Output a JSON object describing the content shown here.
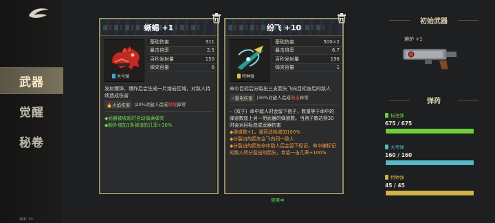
{
  "nav": {
    "items": [
      {
        "label": "武器",
        "active": true
      },
      {
        "label": "觉醒",
        "active": false
      },
      {
        "label": "秘卷",
        "active": false
      }
    ],
    "fps": "帧率: 30"
  },
  "cards": [
    {
      "title": "蜥蜴 +1",
      "ammo": "大号弹",
      "ammo_color": "#4aa0d8",
      "stats": [
        {
          "label": "基础伤害",
          "value": "311"
        },
        {
          "label": "暴击倍率",
          "value": "2.5"
        },
        {
          "label": "百秒发射量",
          "value": "150"
        },
        {
          "label": "弹夹容量",
          "value": "6"
        }
      ],
      "desc": "发射爆弹，爆炸后会生成一片熔岩区域，对敌人持续造成伤害",
      "effect_chip": "火焰伤害",
      "effect_text_pre": "|20%对敌人造成",
      "effect_hl": "燃烧",
      "effect_text_post": "异常",
      "bullets": [
        {
          "text": "◆武器被收起时自动填满弹夹",
          "style": "green"
        },
        {
          "text": "◆额外增加1条弹道的几率+20%",
          "style": "green"
        }
      ]
    },
    {
      "title": "纷飞 +10",
      "ammo": "特种弹",
      "ammo_color": "#d8c64a",
      "stats": [
        {
          "label": "基础伤害",
          "value": "500×2"
        },
        {
          "label": "暴击倍率",
          "value": "6.7"
        },
        {
          "label": "百秒发射量",
          "value": "196"
        },
        {
          "label": "弹夹容量",
          "value": "1"
        }
      ],
      "desc": "命中目标后分裂出三支箭矢飞向目标身后的敌人",
      "effect_chip": "雷电伤害",
      "effect_text_pre": "|30%对敌人造成",
      "effect_hl": "电击",
      "effect_text_post": "异常",
      "bullets": [
        {
          "text": "-（双子）命中敌人时会留下孢子，数量等于命中的弹道数加上另一把武器的弹道数。当孢子数达到30时会对目标造成武器伤害",
          "style": "white"
        },
        {
          "text": "◆弹道数+1，弹药消耗增加100%",
          "style": "orange"
        },
        {
          "text": "◆分裂出的箭矢会飞向同一敌人",
          "style": "orange"
        },
        {
          "text": "◆分裂出的箭矢命中敌人后会留下标记，命中被标记的敌人所分裂出的箭矢，幸运一击几率+100%",
          "style": "orange"
        }
      ]
    }
  ],
  "in_use": "使用中",
  "right": {
    "init_title": "初始武器",
    "init_weapon": "熔炉 +1",
    "ammo_title": "弹药",
    "ammo": [
      {
        "name": "标准弹",
        "count": "675 / 675",
        "color": "#6dcf3a",
        "fill": 1.0
      },
      {
        "name": "大号弹",
        "count": "160 / 160",
        "color": "#58b8c8",
        "fill": 1.0
      },
      {
        "name": "特种弹",
        "count": "45 / 45",
        "color": "#d2b34a",
        "fill": 1.0
      }
    ]
  }
}
